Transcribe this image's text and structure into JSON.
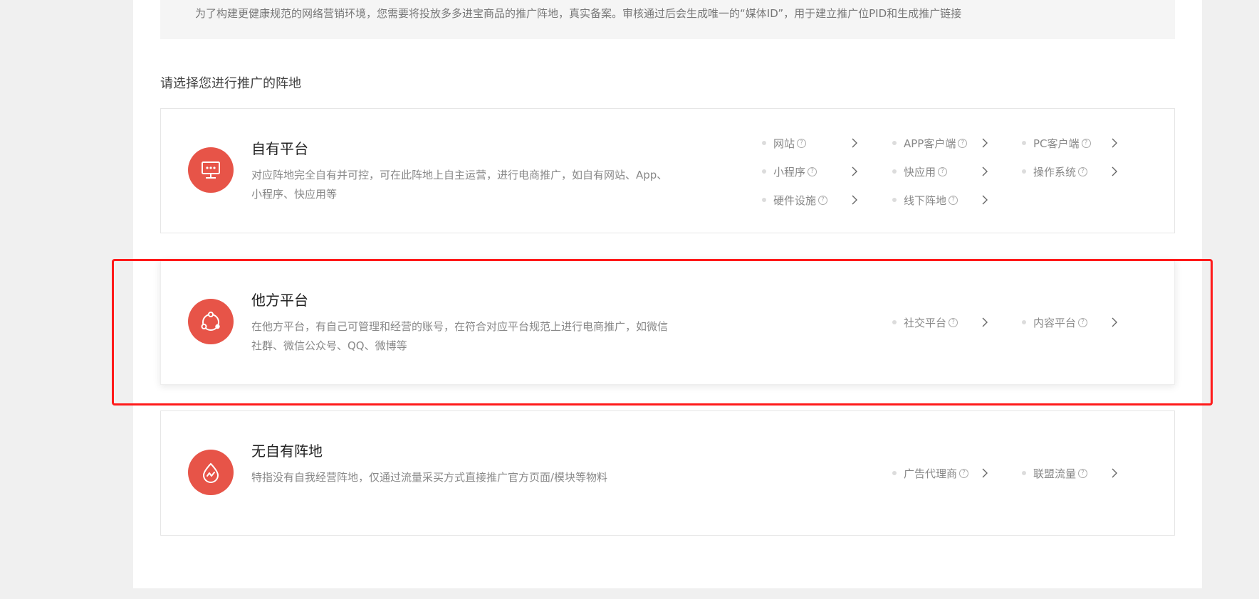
{
  "notice": "为了构建更健康规范的网络营销环境，您需要将投放多多进宝商品的推广阵地，真实备案。审核通过后会生成唯一的“媒体ID”，用于建立推广位PID和生成推广链接",
  "heading": "请选择您进行推广的阵地",
  "help_glyph": "?",
  "cards": [
    {
      "title": "自有平台",
      "desc": "对应阵地完全自有并可控，可在此阵地上自主运营，进行电商推广，如自有网站、App、小程序、快应用等",
      "icon": "monitor-icon",
      "options": [
        "网站",
        "APP客户端",
        "PC客户端",
        "小程序",
        "快应用",
        "操作系统",
        "硬件设施",
        "线下阵地"
      ]
    },
    {
      "title": "他方平台",
      "desc": "在他方平台，有自己可管理和经营的账号，在符合对应平台规范上进行电商推广，如微信社群、微信公众号、QQ、微博等",
      "icon": "share-network-icon",
      "options": [
        "社交平台",
        "内容平台"
      ]
    },
    {
      "title": "无自有阵地",
      "desc": "特指没有自我经营阵地，仅通过流量采买方式直接推广官方页面/模块等物料",
      "icon": "traffic-drop-icon",
      "options": [
        "广告代理商",
        "联盟流量"
      ]
    }
  ],
  "colors": {
    "accent": "#e75448",
    "highlight_border": "#ff1a1a",
    "page_bg": "#f0f0f0",
    "notice_bg": "#f5f5f5"
  }
}
